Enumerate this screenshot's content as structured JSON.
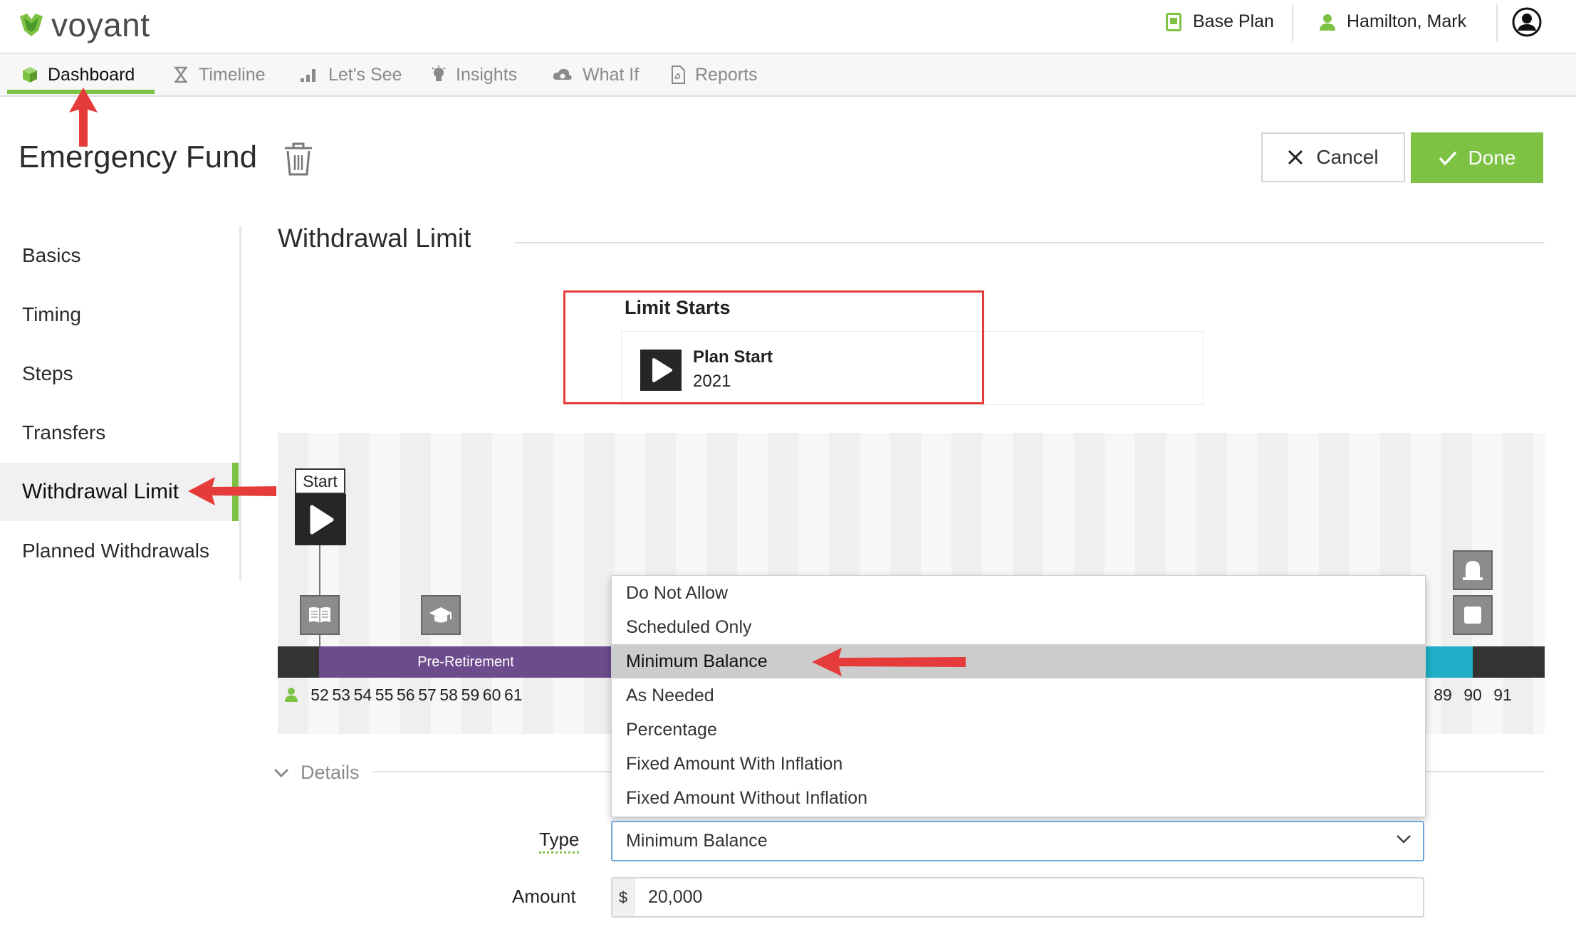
{
  "app": {
    "logo_text": "voyant"
  },
  "topbar": {
    "plan_label": "Base Plan",
    "user_name": "Hamilton, Mark"
  },
  "nav": {
    "tabs": [
      {
        "label": "Dashboard",
        "icon": "cube-icon",
        "active": true
      },
      {
        "label": "Timeline",
        "icon": "hourglass-icon"
      },
      {
        "label": "Let's See",
        "icon": "bar-chart-icon"
      },
      {
        "label": "Insights",
        "icon": "lightbulb-icon"
      },
      {
        "label": "What If",
        "icon": "cloud-gear-icon"
      },
      {
        "label": "Reports",
        "icon": "pdf-icon"
      }
    ]
  },
  "page": {
    "title": "Emergency Fund",
    "cancel_label": "Cancel",
    "done_label": "Done"
  },
  "sidenav": {
    "items": [
      {
        "label": "Basics"
      },
      {
        "label": "Timing"
      },
      {
        "label": "Steps"
      },
      {
        "label": "Transfers"
      },
      {
        "label": "Withdrawal Limit",
        "active": true
      },
      {
        "label": "Planned Withdrawals"
      }
    ]
  },
  "section": {
    "title": "Withdrawal Limit",
    "limit_starts_label": "Limit Starts",
    "limit_start_name": "Plan Start",
    "limit_start_year": "2021"
  },
  "timeline": {
    "start_label": "Start",
    "phase_label": "Pre-Retirement",
    "ages_left": [
      "52",
      "53",
      "54",
      "55",
      "56",
      "57",
      "58",
      "59",
      "60",
      "61"
    ],
    "ages_right": [
      "89",
      "90",
      "91"
    ]
  },
  "details": {
    "label": "Details"
  },
  "dropdown": {
    "options": [
      "Do Not Allow",
      "Scheduled Only",
      "Minimum Balance",
      "As Needed",
      "Percentage",
      "Fixed Amount With Inflation",
      "Fixed Amount Without Inflation"
    ],
    "selected": "Minimum Balance"
  },
  "form": {
    "type_label": "Type",
    "type_value": "Minimum Balance",
    "amount_label": "Amount",
    "amount_prefix": "$",
    "amount_value": "20,000"
  },
  "colors": {
    "accent": "#7dc242",
    "pre_retirement": "#6d4c8e",
    "annotation": "#e53b3b"
  }
}
